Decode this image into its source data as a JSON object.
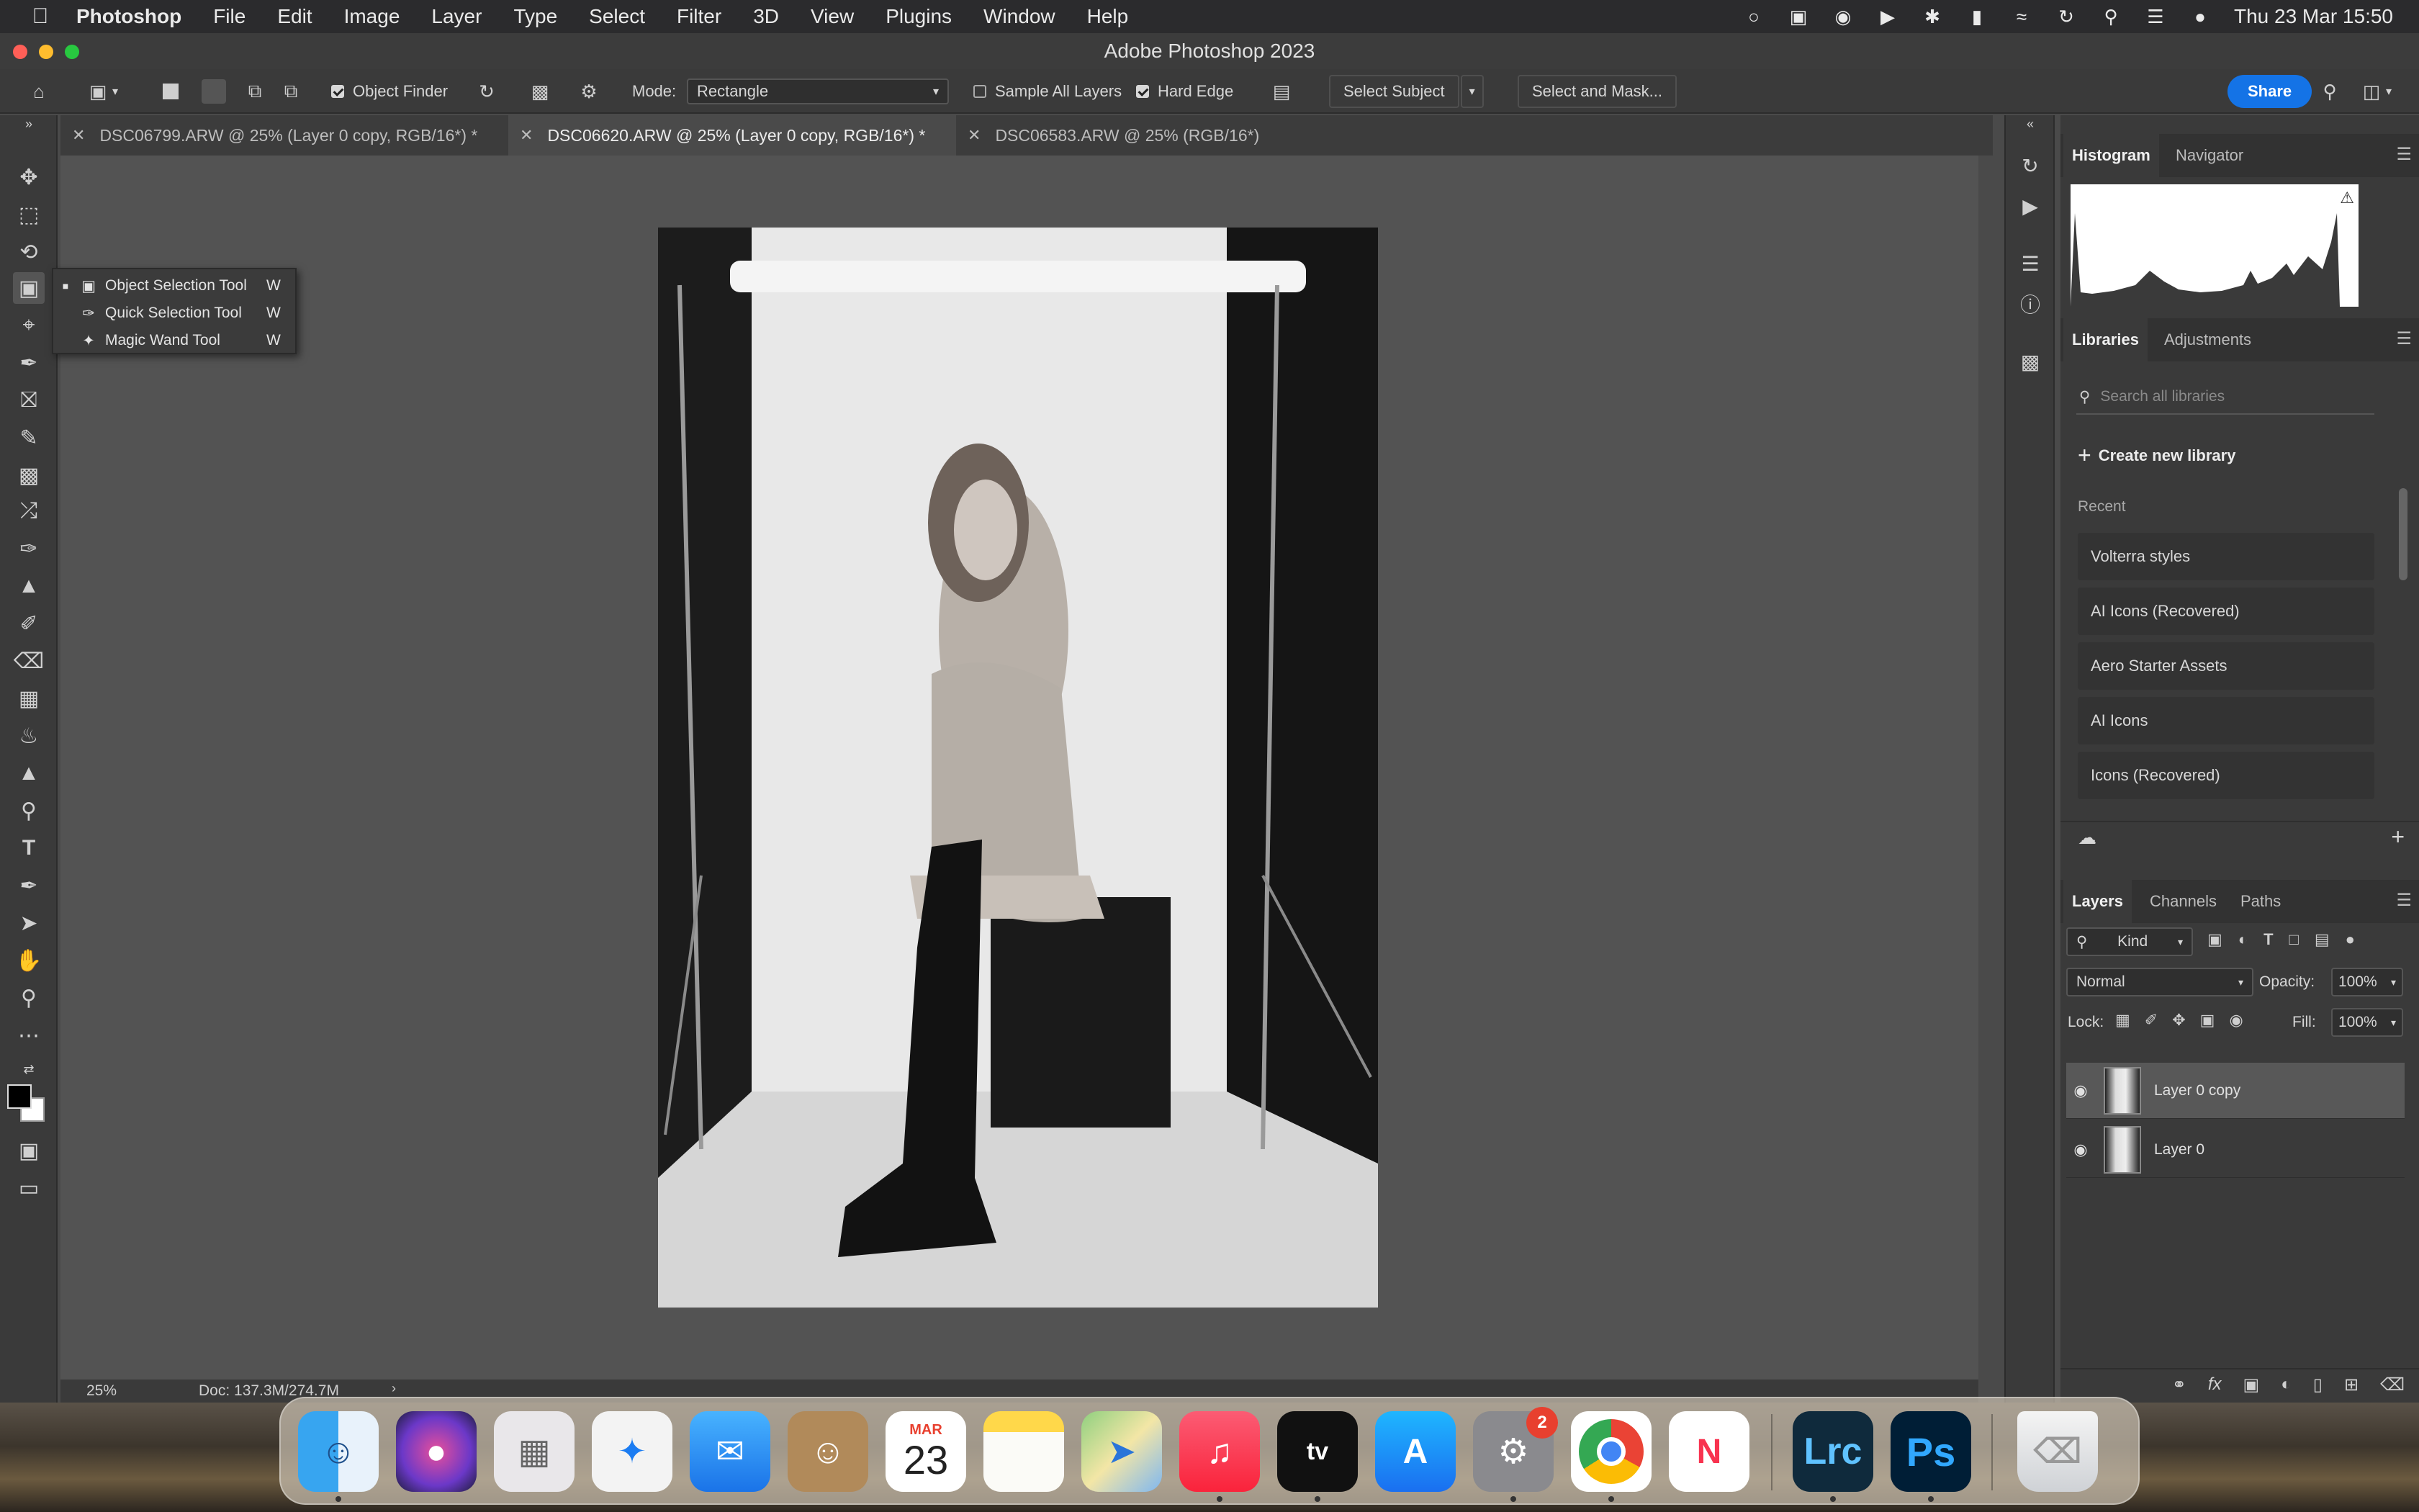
{
  "menubar": {
    "app": "Photoshop",
    "items": [
      "File",
      "Edit",
      "Image",
      "Layer",
      "Type",
      "Select",
      "Filter",
      "3D",
      "View",
      "Plugins",
      "Window",
      "Help"
    ],
    "clock": "Thu 23 Mar  15:50"
  },
  "window": {
    "title": "Adobe Photoshop 2023"
  },
  "options": {
    "object_finder": "Object Finder",
    "mode_label": "Mode:",
    "mode_value": "Rectangle",
    "sample_all_layers": "Sample All Layers",
    "hard_edge": "Hard Edge",
    "select_subject": "Select Subject",
    "select_and_mask": "Select and Mask...",
    "share": "Share"
  },
  "tabs": [
    {
      "label": "DSC06799.ARW @ 25% (Layer 0 copy, RGB/16*) *",
      "active": false
    },
    {
      "label": "DSC06620.ARW @ 25% (Layer 0 copy, RGB/16*) *",
      "active": true
    },
    {
      "label": "DSC06583.ARW @ 25% (RGB/16*)",
      "active": false
    }
  ],
  "flyout": [
    {
      "label": "Object Selection Tool",
      "key": "W",
      "icon": "object-selection-icon",
      "current": true
    },
    {
      "label": "Quick Selection Tool",
      "key": "W",
      "icon": "quick-selection-icon",
      "current": false
    },
    {
      "label": "Magic Wand Tool",
      "key": "W",
      "icon": "magic-wand-icon",
      "current": false
    }
  ],
  "status": {
    "zoom": "25%",
    "doc": "Doc: 137.3M/274.7M"
  },
  "panels": {
    "histogram_tabs": [
      "Histogram",
      "Navigator"
    ],
    "libraries_tabs": [
      "Libraries",
      "Adjustments"
    ],
    "search_placeholder": "Search all libraries",
    "create_library": "Create new library",
    "recent_label": "Recent",
    "libraries": [
      "Volterra styles",
      "AI Icons (Recovered)",
      "Aero Starter Assets",
      "AI Icons",
      "Icons (Recovered)"
    ],
    "layers_tabs": [
      "Layers",
      "Channels",
      "Paths"
    ],
    "kind": "Kind",
    "blend_mode": "Normal",
    "opacity_label": "Opacity:",
    "opacity": "100%",
    "lock_label": "Lock:",
    "fill_label": "Fill:",
    "fill": "100%",
    "layers": [
      {
        "name": "Layer 0 copy",
        "selected": true
      },
      {
        "name": "Layer 0",
        "selected": false
      }
    ]
  },
  "dock": {
    "calendar_month": "MAR",
    "calendar_day": "23",
    "settings_badge": "2",
    "lrc": "Lrc",
    "ps": "Ps"
  },
  "colors": {
    "accent": "#1473e6",
    "panel": "#3a3a3a",
    "canvas": "#535353"
  }
}
